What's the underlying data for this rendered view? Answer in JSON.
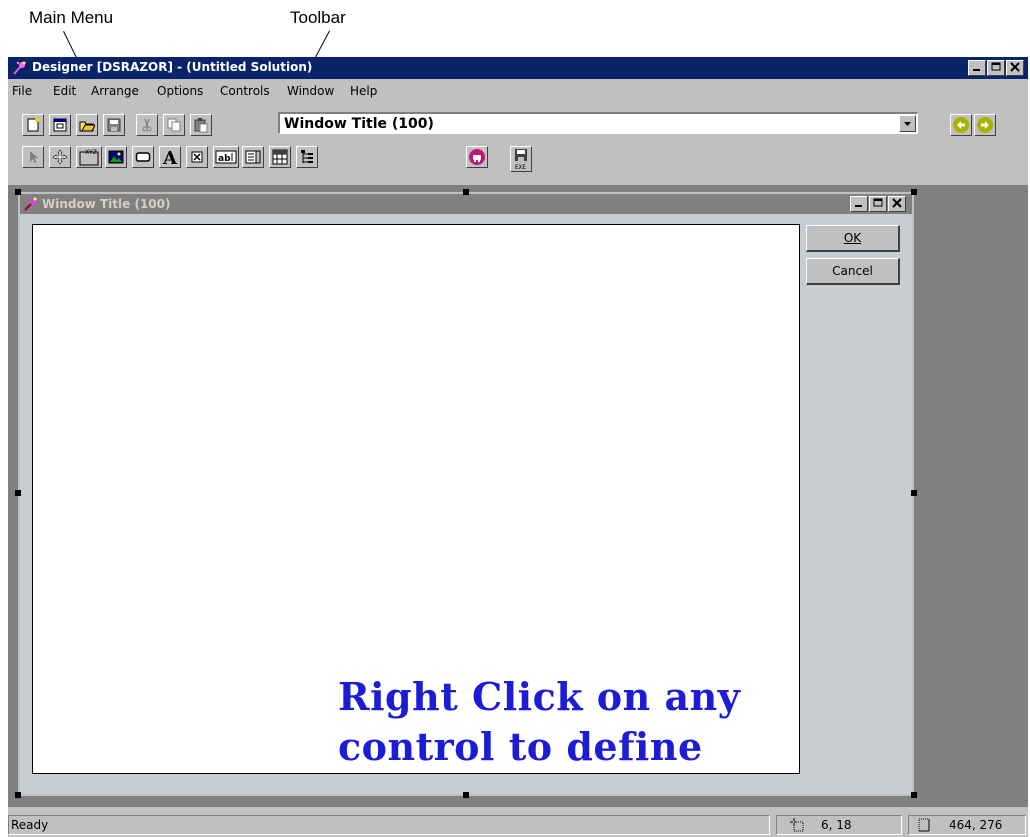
{
  "annotations": {
    "main_menu": "Main Menu",
    "toolbar": "Toolbar"
  },
  "app": {
    "title": "Designer [DSRAZOR] - (Untitled Solution)"
  },
  "menu": {
    "file": "File",
    "edit": "Edit",
    "arrange": "Arrange",
    "options": "Options",
    "controls": "Controls",
    "window": "Window",
    "help": "Help"
  },
  "toolbar": {
    "window_selector_value": "Window Title (100)",
    "icons": [
      "new-icon",
      "new-window-icon",
      "open-icon",
      "save-icon",
      "cut-icon",
      "copy-icon",
      "paste-icon",
      "back-icon",
      "forward-icon"
    ]
  },
  "controls_toolbar": {
    "icons": [
      "pointer-icon",
      "move-icon",
      "group-box-icon",
      "picture-icon",
      "button-icon",
      "label-icon",
      "checkbox-icon",
      "edit-field-icon",
      "list-box-icon",
      "grid-icon",
      "tree-icon",
      "run-icon",
      "build-exe-icon"
    ]
  },
  "child_window": {
    "title": "Window Title (100)",
    "ok_button": "OK",
    "cancel_button": "Cancel",
    "hint": "Right Click on any control to define"
  },
  "status": {
    "text": "Ready",
    "position": "6, 18",
    "size": "464, 276"
  },
  "colors": {
    "titlebar": "#0a246a",
    "hint_text": "#1c1cd6",
    "workspace": "#808080"
  }
}
